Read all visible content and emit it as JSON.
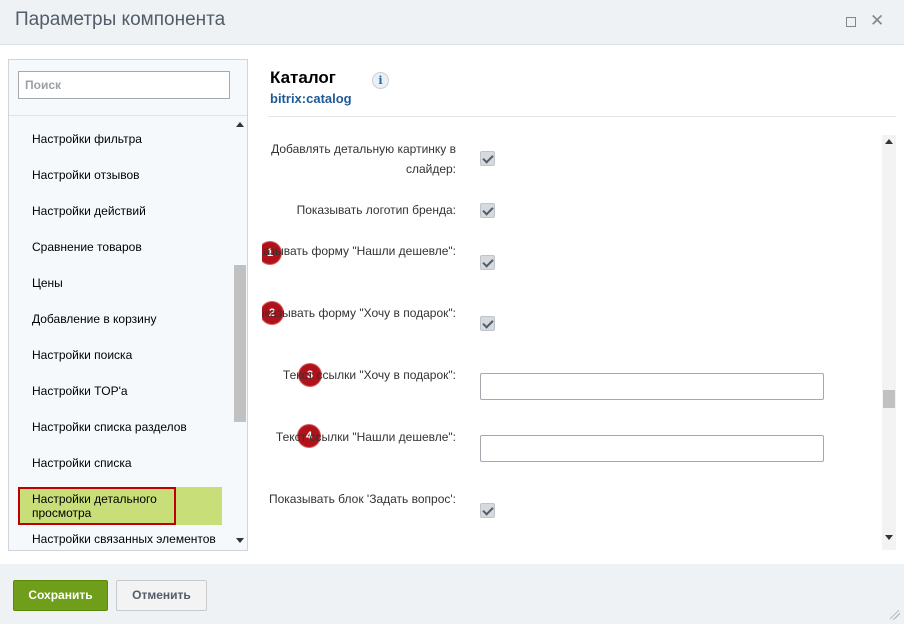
{
  "window": {
    "title": "Параметры компонента"
  },
  "sidebar": {
    "search_placeholder": "Поиск",
    "items": [
      {
        "label": "Настройки фильтра"
      },
      {
        "label": "Настройки отзывов"
      },
      {
        "label": "Настройки действий"
      },
      {
        "label": "Сравнение товаров"
      },
      {
        "label": "Цены"
      },
      {
        "label": "Добавление в корзину"
      },
      {
        "label": "Настройки поиска"
      },
      {
        "label": "Настройки TOP'а"
      },
      {
        "label": "Настройки списка разделов"
      },
      {
        "label": "Настройки списка"
      },
      {
        "label": "Настройки детального просмотра"
      },
      {
        "label": "Настройки связанных элементов"
      }
    ]
  },
  "main": {
    "title": "Каталог",
    "info_icon_glyph": "i",
    "code": "bitrix:catalog",
    "properties": [
      {
        "label": "Добавлять детальную картинку в слайдер:",
        "type": "checkbox",
        "checked": true,
        "badge": ""
      },
      {
        "label": "Показывать логотип бренда:",
        "type": "checkbox",
        "checked": true,
        "badge": ""
      },
      {
        "label": "Показывать форму \"Нашли дешевле\":",
        "type": "checkbox",
        "checked": true,
        "badge": "1"
      },
      {
        "label": "Показывать форму \"Хочу в подарок\":",
        "type": "checkbox",
        "checked": true,
        "badge": "2"
      },
      {
        "label": "Текст ссылки \"Хочу в подарок\":",
        "type": "text",
        "value": "",
        "badge": "3"
      },
      {
        "label": "Текст ссылки \"Нашли дешевле\":",
        "type": "text",
        "value": "",
        "badge": "4"
      },
      {
        "label": "Показывать блок 'Задать вопрос':",
        "type": "checkbox",
        "checked": true,
        "badge": ""
      }
    ]
  },
  "footer": {
    "save_label": "Сохранить",
    "cancel_label": "Отменить"
  }
}
